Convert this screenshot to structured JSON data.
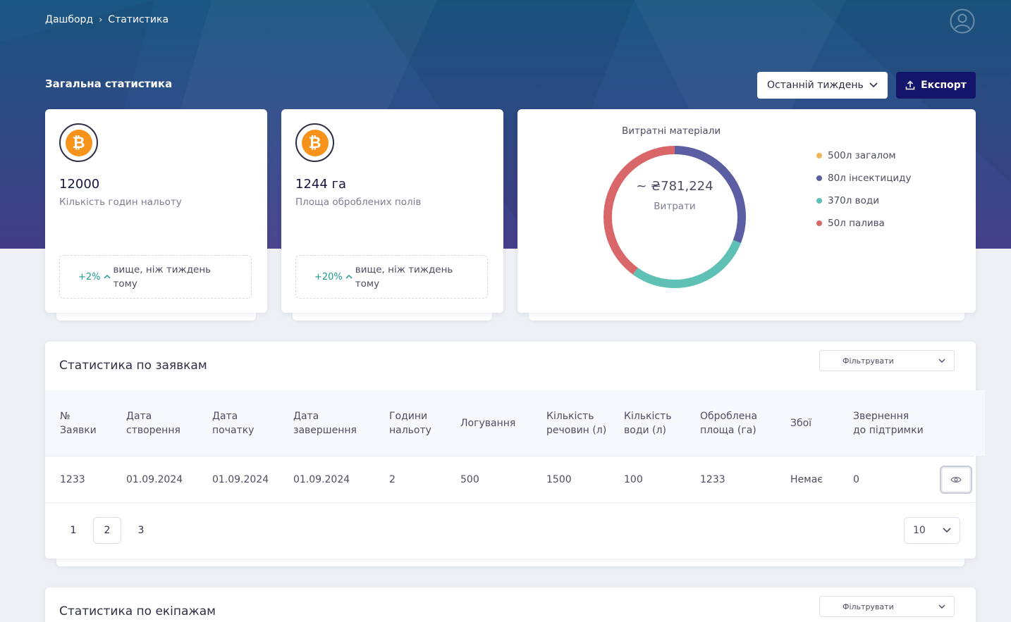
{
  "breadcrumb": {
    "home": "Дашборд",
    "current": "Статистика"
  },
  "header": {
    "title": "Загальна статистика",
    "period": "Останній тиждень",
    "export_label": "Експорт"
  },
  "stats": [
    {
      "value": "12000",
      "label": "Кількість годин нальоту",
      "trend_pct": "+2%",
      "trend_text": "вище, ніж тиждень тому"
    },
    {
      "value": "1244 га",
      "label": "Площа оброблених полів",
      "trend_pct": "+20%",
      "trend_text": "вище, ніж тиждень тому"
    }
  ],
  "consumables": {
    "title": "Витратні матеріали",
    "total": "~ ₴781,224",
    "total_label": "Витрати",
    "legend": [
      {
        "label": "500л загалом",
        "color": "#f1b657"
      },
      {
        "label": "80л інсектициду",
        "color": "#5c5ea3"
      },
      {
        "label": "370л води",
        "color": "#5fc1b6"
      },
      {
        "label": "50л палива",
        "color": "#d9676a"
      }
    ]
  },
  "chart_data": {
    "type": "pie",
    "title": "Витратні матеріали",
    "categories": [
      "80л інсектициду",
      "370л води",
      "50л палива"
    ],
    "values": [
      31,
      29,
      40
    ],
    "colors": [
      "#5c5ea3",
      "#5fc1b6",
      "#d9676a"
    ]
  },
  "requests": {
    "title": "Статистика по заявкам",
    "filter_label": "Фільтрувати",
    "columns": [
      "№ Заявки",
      "Дата створення",
      "Дата початку",
      "Дата завершення",
      "Години нальоту",
      "Логування",
      "Кількість речовин (л)",
      "Кількість води (л)",
      "Оброблена площа (га)",
      "Збої",
      "Звернення до підтримки"
    ],
    "rows": [
      [
        "1233",
        "01.09.2024",
        "01.09.2024",
        "01.09.2024",
        "2",
        "500",
        "1500",
        "100",
        "1233",
        "Немає",
        "0"
      ]
    ],
    "pages": [
      "1",
      "2",
      "3"
    ],
    "active_page": "2",
    "page_size": "10"
  },
  "crews": {
    "title": "Статистика по екіпажам",
    "filter_label": "Фільтрувати"
  }
}
